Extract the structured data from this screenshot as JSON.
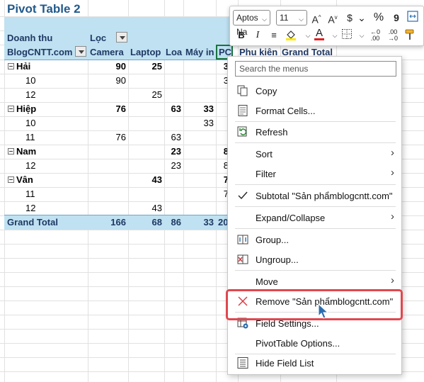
{
  "pivot": {
    "title": "Pivot Table 2",
    "header_row1": {
      "values_label": "Doanh thu",
      "col_filter_label": "Lọc"
    },
    "header_row2": {
      "row_field": "BlogCNTT.com",
      "columns": [
        "Camera",
        "Laptop",
        "Loa",
        "Máy in",
        "PC",
        "Phụ kiện",
        "Grand Total"
      ]
    },
    "groups": [
      {
        "name": "Hải",
        "camera": "90",
        "laptop": "25",
        "loa": "",
        "mayin": "",
        "pc": "3",
        "rows": [
          {
            "label": "10",
            "camera": "90",
            "laptop": "",
            "loa": "",
            "mayin": "",
            "pc": "3"
          },
          {
            "label": "12",
            "camera": "",
            "laptop": "25",
            "loa": "",
            "mayin": "",
            "pc": ""
          }
        ]
      },
      {
        "name": "Hiệp",
        "camera": "76",
        "laptop": "",
        "loa": "63",
        "mayin": "33",
        "pc": "",
        "rows": [
          {
            "label": "10",
            "camera": "",
            "laptop": "",
            "loa": "",
            "mayin": "33",
            "pc": ""
          },
          {
            "label": "11",
            "camera": "76",
            "laptop": "",
            "loa": "63",
            "mayin": "",
            "pc": ""
          }
        ]
      },
      {
        "name": "Nam",
        "camera": "",
        "laptop": "",
        "loa": "23",
        "mayin": "",
        "pc": "8",
        "rows": [
          {
            "label": "12",
            "camera": "",
            "laptop": "",
            "loa": "23",
            "mayin": "",
            "pc": "8"
          }
        ]
      },
      {
        "name": "Vân",
        "camera": "",
        "laptop": "43",
        "loa": "",
        "mayin": "",
        "pc": "7",
        "rows": [
          {
            "label": "11",
            "camera": "",
            "laptop": "",
            "loa": "",
            "mayin": "",
            "pc": "7"
          },
          {
            "label": "12",
            "camera": "",
            "laptop": "43",
            "loa": "",
            "mayin": "",
            "pc": ""
          }
        ]
      }
    ],
    "grand_total": {
      "label": "Grand Total",
      "camera": "166",
      "laptop": "68",
      "loa": "86",
      "mayin": "33",
      "pc": "20"
    }
  },
  "mini_toolbar": {
    "font_name": "Aptos Na",
    "font_size": "11",
    "icons": [
      "font-grow-icon",
      "font-shrink-icon",
      "currency-icon",
      "percent-icon",
      "comma-style-icon",
      "bold-icon",
      "italic-icon",
      "align-center-icon",
      "fill-color-icon",
      "font-color-icon",
      "borders-icon",
      "increase-decimal-icon",
      "decrease-decimal-icon",
      "format-painter-icon"
    ]
  },
  "menu": {
    "search_placeholder": "Search the menus",
    "copy": "Copy",
    "format_cells": "Format Cells...",
    "refresh": "Refresh",
    "sort": "Sort",
    "filter": "Filter",
    "subtotal": "Subtotal \"Sản phẩmblogcntt.com\"",
    "expand_collapse": "Expand/Collapse",
    "group": "Group...",
    "ungroup": "Ungroup...",
    "move": "Move",
    "remove": "Remove \"Sản phẩmblogcntt.com\"",
    "field_settings": "Field Settings...",
    "pivot_options": "PivotTable Options...",
    "hide_field_list": "Hide Field List"
  },
  "colors": {
    "pivot_header_fill": "#bfe1f1",
    "pivot_title": "#215a8c",
    "highlight_border": "#e0474f",
    "remove_icon": "#d9363e"
  }
}
